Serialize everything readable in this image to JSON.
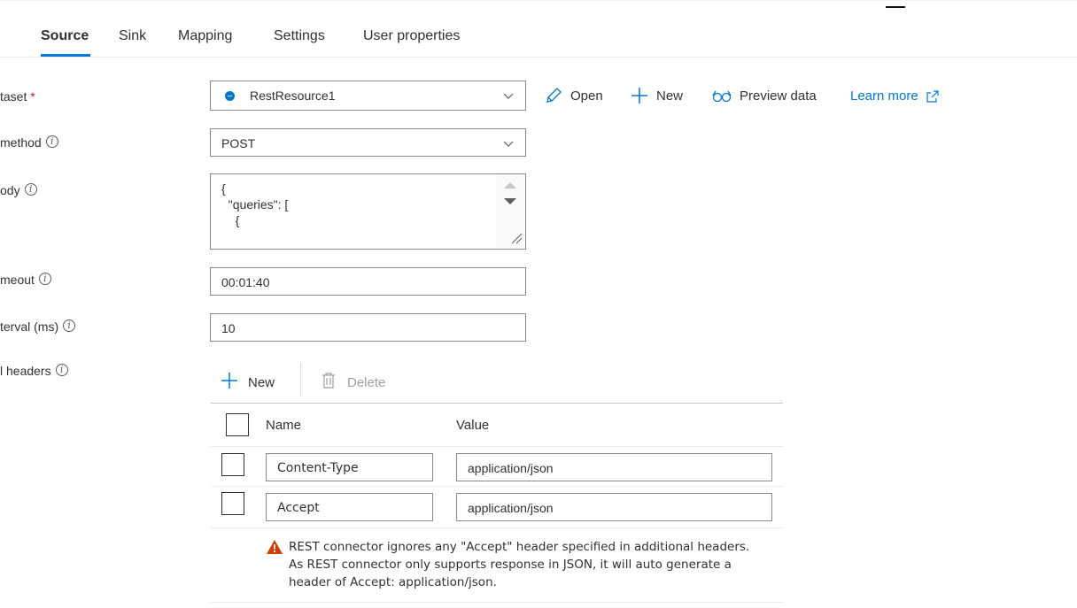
{
  "tabs": [
    {
      "label": "Source",
      "active": true
    },
    {
      "label": "Sink"
    },
    {
      "label": "Mapping"
    },
    {
      "label": "Settings"
    },
    {
      "label": "User properties"
    }
  ],
  "fields": {
    "dataset": {
      "label": "taset",
      "required_mark": "*",
      "value": "RestResource1"
    },
    "method": {
      "label": "method",
      "value": "POST"
    },
    "body": {
      "label": "ody",
      "value": "{\n  \"queries\": [\n    {"
    },
    "timeout": {
      "label": "meout",
      "value": "00:01:40"
    },
    "interval": {
      "label": "terval (ms)",
      "value": "10"
    },
    "headers": {
      "label": "l headers"
    }
  },
  "dataset_actions": {
    "open": "Open",
    "new": "New",
    "preview": "Preview data",
    "learn_more": "Learn more"
  },
  "headers_grid": {
    "new_label": "New",
    "delete_label": "Delete",
    "columns": [
      "Name",
      "Value"
    ],
    "rows": [
      {
        "name": "Content-Type",
        "value": "application/json"
      },
      {
        "name": "Accept",
        "value": "application/json"
      }
    ],
    "warning": "REST connector ignores any \"Accept\" header specified in additional headers. As REST connector only supports response in JSON, it will auto generate a header of Accept: application/json."
  },
  "colors": {
    "accent": "#0078d4",
    "warning": "#d83b01",
    "required": "#a4262c"
  },
  "info_icon_glyph": "i"
}
